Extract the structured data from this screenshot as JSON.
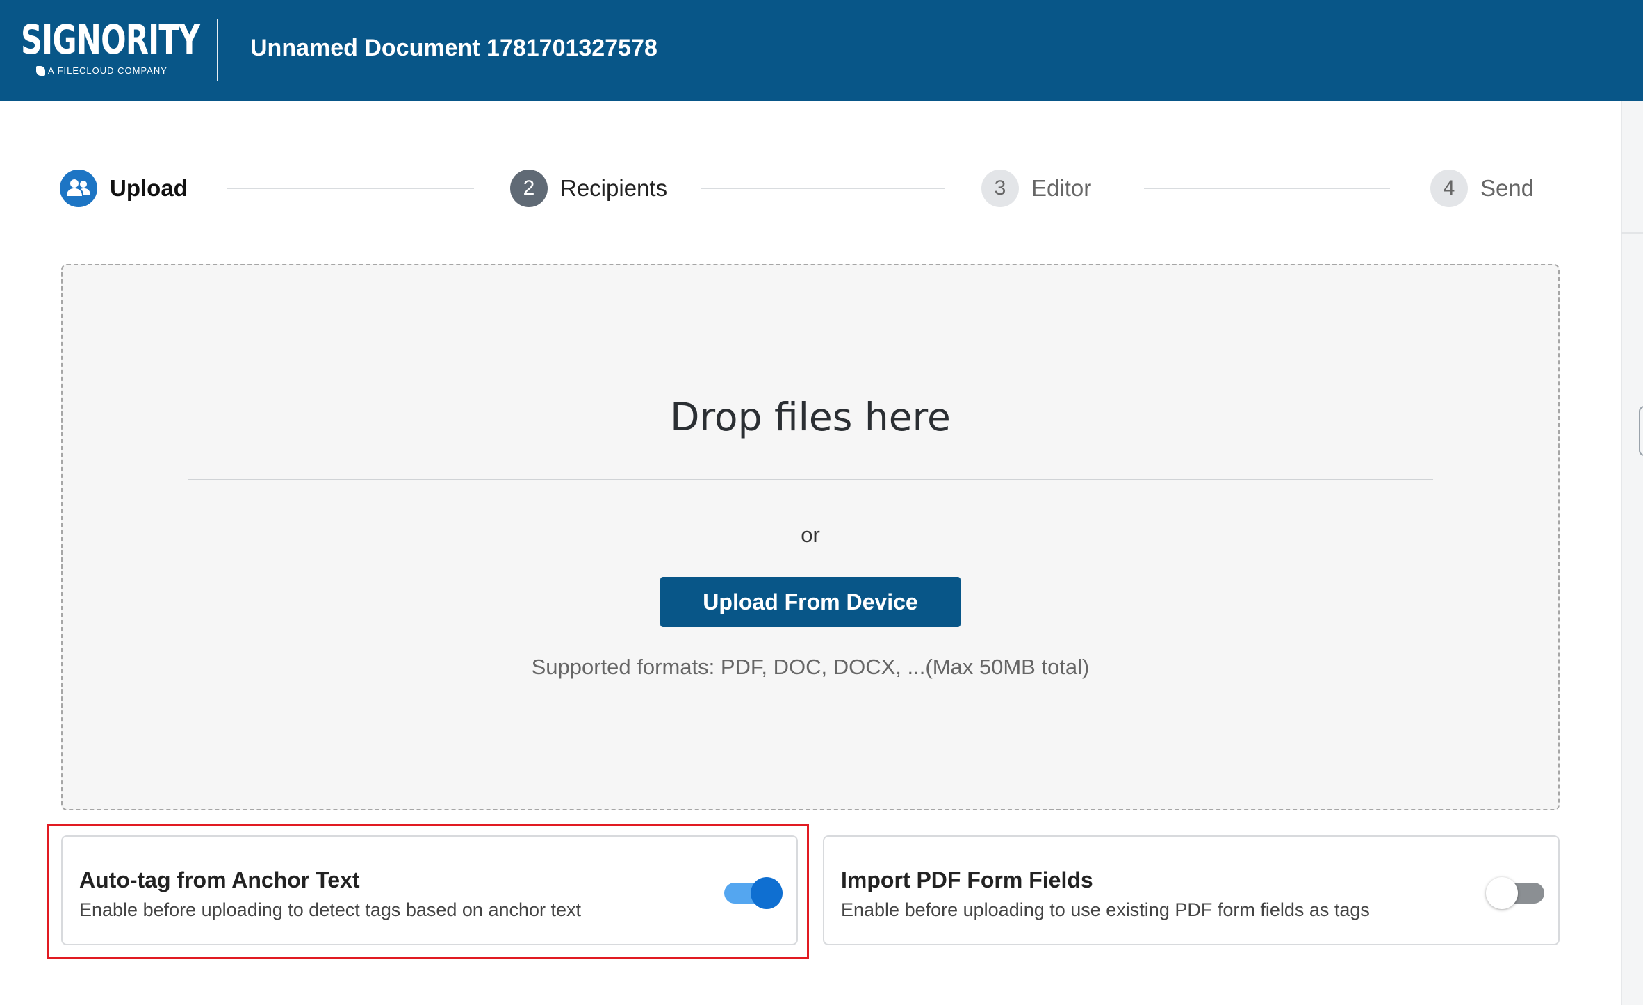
{
  "brand": {
    "logo_text": "SIGNORITY",
    "logo_subtext": "A FILECLOUD COMPANY"
  },
  "header": {
    "document_title": "Unnamed Document 1781701327578"
  },
  "stepper": {
    "steps": [
      {
        "number": "",
        "label": "Upload",
        "icon": "users-icon",
        "state": "active"
      },
      {
        "number": "2",
        "label": "Recipients",
        "state": "next"
      },
      {
        "number": "3",
        "label": "Editor",
        "state": "pending"
      },
      {
        "number": "4",
        "label": "Send",
        "state": "pending"
      }
    ]
  },
  "dropzone": {
    "title": "Drop files here",
    "or_text": "or",
    "upload_button": "Upload From Device",
    "formats_text": "Supported formats: PDF, DOC, DOCX, ...(Max 50MB total)"
  },
  "options": [
    {
      "title": "Auto-tag from Anchor Text",
      "description": "Enable before uploading to detect tags based on anchor text",
      "enabled": true
    },
    {
      "title": "Import PDF Form Fields",
      "description": "Enable before uploading to use existing PDF form fields as tags",
      "enabled": false
    }
  ],
  "colors": {
    "header_bg": "#085688",
    "accent": "#1d75c4",
    "toggle_on": "#0f6fd1",
    "highlight": "#e11b22"
  }
}
